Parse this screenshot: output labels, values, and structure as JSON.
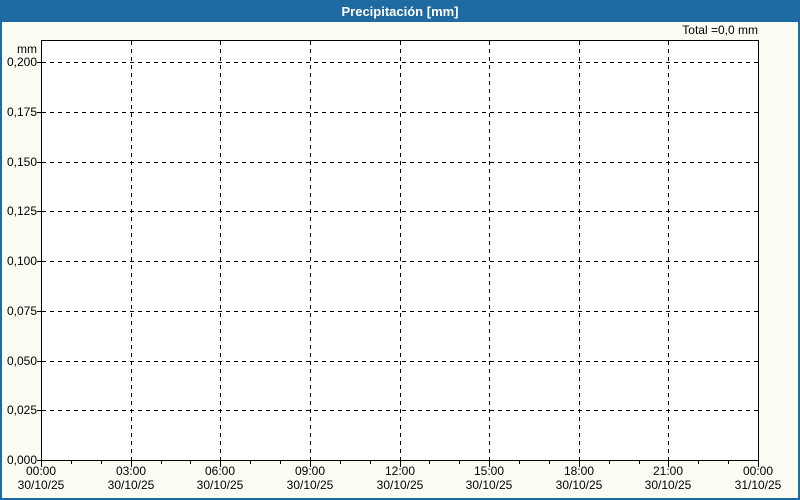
{
  "window": {
    "title": "Precipitación [mm]"
  },
  "summary": {
    "total": "Total =0,0 mm"
  },
  "chart_data": {
    "type": "bar",
    "title": "Precipitación [mm]",
    "ylabel": "mm",
    "xlabel": "",
    "ylim": [
      0,
      0.211
    ],
    "grid": "dashed",
    "legend_position": "none",
    "total_precipitation_mm": 0.0,
    "y_ticks": [
      {
        "label": "0,200",
        "value": 0.2
      },
      {
        "label": "0,175",
        "value": 0.175
      },
      {
        "label": "0,150",
        "value": 0.15
      },
      {
        "label": "0,125",
        "value": 0.125
      },
      {
        "label": "0,100",
        "value": 0.1
      },
      {
        "label": "0,075",
        "value": 0.075
      },
      {
        "label": "0,050",
        "value": 0.05
      },
      {
        "label": "0,025",
        "value": 0.025
      },
      {
        "label": "0,000",
        "value": 0.0
      }
    ],
    "x_ticks": [
      {
        "hour": 0,
        "time": "00:00",
        "date": "30/10/25"
      },
      {
        "hour": 3,
        "time": "03:00",
        "date": "30/10/25"
      },
      {
        "hour": 6,
        "time": "06:00",
        "date": "30/10/25"
      },
      {
        "hour": 9,
        "time": "09:00",
        "date": "30/10/25"
      },
      {
        "hour": 12,
        "time": "12:00",
        "date": "30/10/25"
      },
      {
        "hour": 15,
        "time": "15:00",
        "date": "30/10/25"
      },
      {
        "hour": 18,
        "time": "18:00",
        "date": "30/10/25"
      },
      {
        "hour": 21,
        "time": "21:00",
        "date": "30/10/25"
      },
      {
        "hour": 24,
        "time": "00:00",
        "date": "31/10/25"
      }
    ],
    "x_total_hours": 24,
    "minor_tick_interval_hours": 1,
    "series": [
      {
        "name": "Precipitación",
        "values": []
      }
    ]
  },
  "colors": {
    "title_bar": "#1E6AA1",
    "title_text": "#FFFFFF",
    "frame": "#1E6AA1",
    "background": "#FBFCF4",
    "plot_background": "#FFFFFF",
    "axis": "#000000",
    "grid": "#000000",
    "text": "#000000"
  }
}
